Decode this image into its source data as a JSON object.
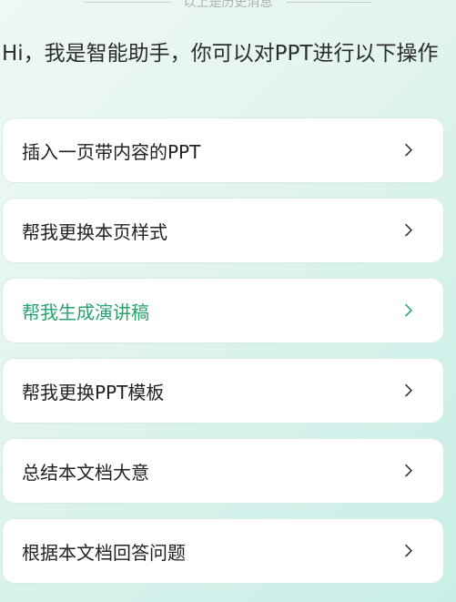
{
  "history_divider": "以上是历史消息",
  "intro_text": "Hi，我是智能助手，你可以对PPT进行以下操作",
  "options": [
    {
      "label": "插入一页带内容的PPT",
      "active": false
    },
    {
      "label": "帮我更换本页样式",
      "active": false
    },
    {
      "label": "帮我生成演讲稿",
      "active": true
    },
    {
      "label": "帮我更换PPT模板",
      "active": false
    },
    {
      "label": "总结本文档大意",
      "active": false
    },
    {
      "label": "根据本文档回答问题",
      "active": false
    }
  ],
  "icons": {
    "item_arrow": "chevron-right-icon"
  },
  "colors": {
    "active_text": "#2aa36f",
    "background": "#d3f1ea"
  }
}
